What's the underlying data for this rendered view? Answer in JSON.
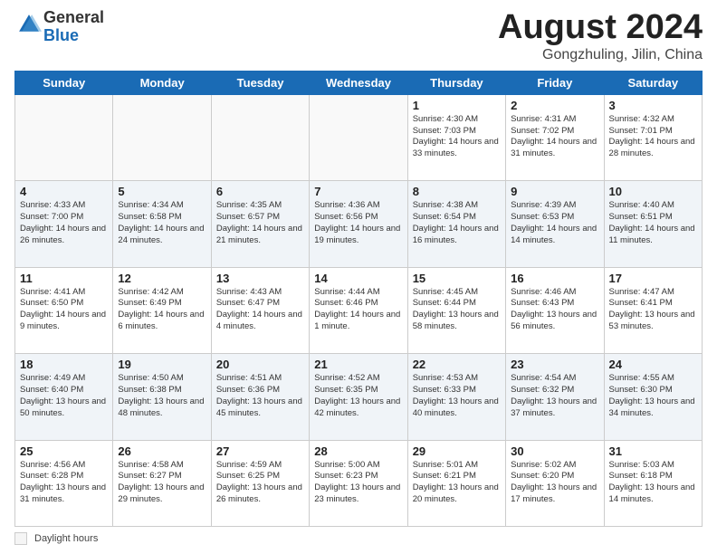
{
  "header": {
    "logo_line1": "General",
    "logo_line2": "Blue",
    "month_title": "August 2024",
    "subtitle": "Gongzhuling, Jilin, China"
  },
  "weekdays": [
    "Sunday",
    "Monday",
    "Tuesday",
    "Wednesday",
    "Thursday",
    "Friday",
    "Saturday"
  ],
  "legend": {
    "label": "Daylight hours"
  },
  "weeks": [
    [
      {
        "day": "",
        "info": ""
      },
      {
        "day": "",
        "info": ""
      },
      {
        "day": "",
        "info": ""
      },
      {
        "day": "",
        "info": ""
      },
      {
        "day": "1",
        "info": "Sunrise: 4:30 AM\nSunset: 7:03 PM\nDaylight: 14 hours\nand 33 minutes."
      },
      {
        "day": "2",
        "info": "Sunrise: 4:31 AM\nSunset: 7:02 PM\nDaylight: 14 hours\nand 31 minutes."
      },
      {
        "day": "3",
        "info": "Sunrise: 4:32 AM\nSunset: 7:01 PM\nDaylight: 14 hours\nand 28 minutes."
      }
    ],
    [
      {
        "day": "4",
        "info": "Sunrise: 4:33 AM\nSunset: 7:00 PM\nDaylight: 14 hours\nand 26 minutes."
      },
      {
        "day": "5",
        "info": "Sunrise: 4:34 AM\nSunset: 6:58 PM\nDaylight: 14 hours\nand 24 minutes."
      },
      {
        "day": "6",
        "info": "Sunrise: 4:35 AM\nSunset: 6:57 PM\nDaylight: 14 hours\nand 21 minutes."
      },
      {
        "day": "7",
        "info": "Sunrise: 4:36 AM\nSunset: 6:56 PM\nDaylight: 14 hours\nand 19 minutes."
      },
      {
        "day": "8",
        "info": "Sunrise: 4:38 AM\nSunset: 6:54 PM\nDaylight: 14 hours\nand 16 minutes."
      },
      {
        "day": "9",
        "info": "Sunrise: 4:39 AM\nSunset: 6:53 PM\nDaylight: 14 hours\nand 14 minutes."
      },
      {
        "day": "10",
        "info": "Sunrise: 4:40 AM\nSunset: 6:51 PM\nDaylight: 14 hours\nand 11 minutes."
      }
    ],
    [
      {
        "day": "11",
        "info": "Sunrise: 4:41 AM\nSunset: 6:50 PM\nDaylight: 14 hours\nand 9 minutes."
      },
      {
        "day": "12",
        "info": "Sunrise: 4:42 AM\nSunset: 6:49 PM\nDaylight: 14 hours\nand 6 minutes."
      },
      {
        "day": "13",
        "info": "Sunrise: 4:43 AM\nSunset: 6:47 PM\nDaylight: 14 hours\nand 4 minutes."
      },
      {
        "day": "14",
        "info": "Sunrise: 4:44 AM\nSunset: 6:46 PM\nDaylight: 14 hours\nand 1 minute."
      },
      {
        "day": "15",
        "info": "Sunrise: 4:45 AM\nSunset: 6:44 PM\nDaylight: 13 hours\nand 58 minutes."
      },
      {
        "day": "16",
        "info": "Sunrise: 4:46 AM\nSunset: 6:43 PM\nDaylight: 13 hours\nand 56 minutes."
      },
      {
        "day": "17",
        "info": "Sunrise: 4:47 AM\nSunset: 6:41 PM\nDaylight: 13 hours\nand 53 minutes."
      }
    ],
    [
      {
        "day": "18",
        "info": "Sunrise: 4:49 AM\nSunset: 6:40 PM\nDaylight: 13 hours\nand 50 minutes."
      },
      {
        "day": "19",
        "info": "Sunrise: 4:50 AM\nSunset: 6:38 PM\nDaylight: 13 hours\nand 48 minutes."
      },
      {
        "day": "20",
        "info": "Sunrise: 4:51 AM\nSunset: 6:36 PM\nDaylight: 13 hours\nand 45 minutes."
      },
      {
        "day": "21",
        "info": "Sunrise: 4:52 AM\nSunset: 6:35 PM\nDaylight: 13 hours\nand 42 minutes."
      },
      {
        "day": "22",
        "info": "Sunrise: 4:53 AM\nSunset: 6:33 PM\nDaylight: 13 hours\nand 40 minutes."
      },
      {
        "day": "23",
        "info": "Sunrise: 4:54 AM\nSunset: 6:32 PM\nDaylight: 13 hours\nand 37 minutes."
      },
      {
        "day": "24",
        "info": "Sunrise: 4:55 AM\nSunset: 6:30 PM\nDaylight: 13 hours\nand 34 minutes."
      }
    ],
    [
      {
        "day": "25",
        "info": "Sunrise: 4:56 AM\nSunset: 6:28 PM\nDaylight: 13 hours\nand 31 minutes."
      },
      {
        "day": "26",
        "info": "Sunrise: 4:58 AM\nSunset: 6:27 PM\nDaylight: 13 hours\nand 29 minutes."
      },
      {
        "day": "27",
        "info": "Sunrise: 4:59 AM\nSunset: 6:25 PM\nDaylight: 13 hours\nand 26 minutes."
      },
      {
        "day": "28",
        "info": "Sunrise: 5:00 AM\nSunset: 6:23 PM\nDaylight: 13 hours\nand 23 minutes."
      },
      {
        "day": "29",
        "info": "Sunrise: 5:01 AM\nSunset: 6:21 PM\nDaylight: 13 hours\nand 20 minutes."
      },
      {
        "day": "30",
        "info": "Sunrise: 5:02 AM\nSunset: 6:20 PM\nDaylight: 13 hours\nand 17 minutes."
      },
      {
        "day": "31",
        "info": "Sunrise: 5:03 AM\nSunset: 6:18 PM\nDaylight: 13 hours\nand 14 minutes."
      }
    ]
  ]
}
